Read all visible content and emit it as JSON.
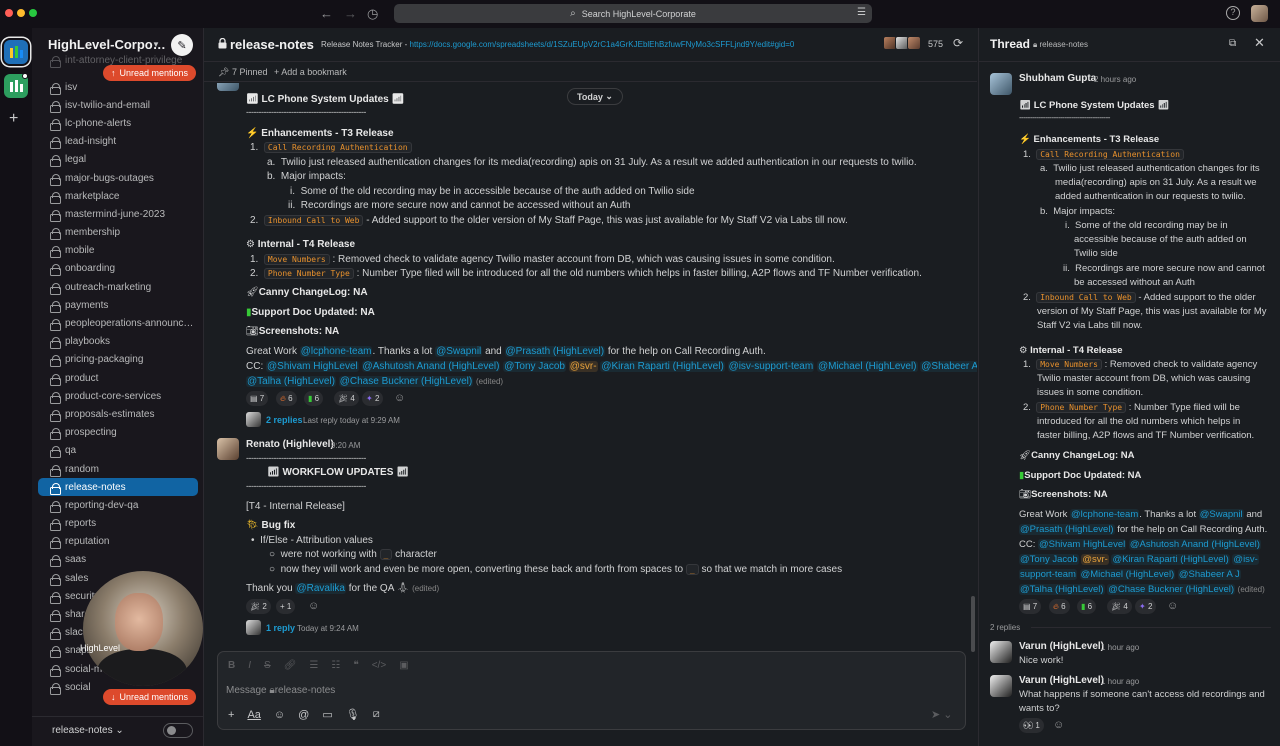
{
  "search": {
    "placeholder": "Search HighLevel-Corporate"
  },
  "workspace": {
    "name": "HighLevel-Corpo…"
  },
  "sidebar": {
    "partial_top": "int-attorney-client-privilege",
    "unread_label": "Unread mentions",
    "channels": [
      "isv",
      "isv-twilio-and-email",
      "lc-phone-alerts",
      "lead-insight",
      "legal",
      "major-bugs-outages",
      "marketplace",
      "mastermind-june-2023",
      "membership",
      "mobile",
      "onboarding",
      "outreach-marketing",
      "payments",
      "peopleoperations-announc…",
      "playbooks",
      "pricing-packaging",
      "product",
      "product-core-services",
      "proposals-estimates",
      "prospecting",
      "qa",
      "random",
      "release-notes",
      "reporting-dev-qa",
      "reports",
      "reputation",
      "saas",
      "sales",
      "security",
      "shared",
      "slack-help",
      "snapshots",
      "social-media-posting",
      "social"
    ],
    "selected": "release-notes",
    "footer_label": "release-notes",
    "video_label": "HighLevel"
  },
  "channel": {
    "title": "release-notes",
    "tracker_label": "Release Notes Tracker -",
    "tracker_link": "https://docs.google.com/spreadsheets/d/1SZuEUpV2rC1a4GrKJEblEhBzfuwFNyMo3cSFFLjnd9Y/edit#gid=0",
    "member_count": "575",
    "pinned": "7 Pinned",
    "add_bookmark": "Add a bookmark",
    "today": "Today"
  },
  "msg1": {
    "heading": "LC Phone System Updates",
    "dashes": "------------------------------------------------",
    "enh_title": "Enhancements - T3 Release",
    "item1_code": "Call Recording Authentication",
    "item1_a": "Twilio just released authentication changes for its media(recording) apis on 31 July. As a result we added authentication in our requests to twilio.",
    "item1_b": "Major impacts:",
    "item1_b_i": "Some of the old recording may be in accessible because of the auth added on Twilio side",
    "item1_b_ii": "Recordings are more secure now and cannot be accessed without an Auth",
    "item2_code": "Inbound Call to Web",
    "item2_text": "- Added support to the older version of My Staff Page, this was just available for My Staff V2 via Labs till now.",
    "int_title": "Internal - T4 Release",
    "int1_code": "Move Numbers",
    "int1_text": ": Removed check to validate agency Twilio master account from DB, which was causing issues in some condition.",
    "int2_code": "Phone Number Type",
    "int2_text": ": Number Type filed will be introduced for all the old numbers which helps in faster billing, A2P flows and TF Number verification.",
    "canny": "Canny ChangeLog: NA",
    "support": "Support Doc Updated: NA",
    "screens": "Screenshots: NA",
    "thanks_pre": "Great Work",
    "m_lcphone": "@lcphone-team",
    "thanks_mid": ". Thanks a lot",
    "m_swapnil": "@Swapnil",
    "and": "and",
    "m_prasath": "@Prasath (HighLevel)",
    "thanks_post": "for the help on Call Recording Auth.",
    "cc": "CC:",
    "m_shivam": "@Shivam HighLevel",
    "m_ashutosh": "@Ashutosh Anand (HighLevel)",
    "m_tony": "@Tony Jacob",
    "m_svr": "@svr-",
    "m_kiran": "@Kiran Raparti (HighLevel)",
    "m_isv": "@isv-support-team",
    "m_michael": "@Michael (HighLevel)",
    "m_shabeer": "@Shabeer A J",
    "m_talha": "@Talha (HighLevel)",
    "m_chase": "@Chase Buckner (HighLevel)",
    "edited": "(edited)",
    "reactions": [
      "7",
      "6",
      "6",
      "4",
      "2"
    ],
    "replies": "2 replies",
    "last_reply": "Last reply today at 9:29 AM"
  },
  "msg2": {
    "author": "Renato (Highlevel)",
    "time": "9:20 AM",
    "dashes": "------------------------------------------------",
    "heading": "WORKFLOW UPDATES",
    "release": "[T4 - Internal Release]",
    "bugfix": "Bug fix",
    "bullet": "If/Else - Attribution values",
    "sub1_pre": "were not working with",
    "sub1_code": "_",
    "sub1_post": "character",
    "sub2_pre": "now they will work and even be more open, converting these back and forth from spaces to",
    "sub2_code": "_",
    "sub2_post": "so that we match in more cases",
    "thanks_pre": "Thank you",
    "m_ravalika": "@Ravalika",
    "thanks_post": "for the QA",
    "edited": "(edited)",
    "reactions": [
      "2",
      "1"
    ],
    "replies": "1 reply",
    "last_reply": "Today at 9:24 AM"
  },
  "composer": {
    "placeholder": "Message",
    "channel": "release-notes"
  },
  "thread": {
    "title": "Thread",
    "channel": "release-notes",
    "author": "Shubham Gupta",
    "time": "2 hours ago",
    "heading": "LC Phone System Updates",
    "dashes": "------------------------------------------",
    "enh_title": "Enhancements - T3 Release",
    "item1_code": "Call Recording Authentication",
    "a1": "Twilio just released authentication changes for its",
    "a2": "media(recording) apis on 31 July. As a result we",
    "a3": "added authentication in our requests to twilio.",
    "b": "Major impacts:",
    "i1": "Some of the old recording may be in",
    "i2": "accessible because of the auth added on",
    "i3": "Twilio side",
    "ii1": "Recordings are more secure now and cannot",
    "ii2": "be accessed without an Auth",
    "item2_code": "Inbound Call to Web",
    "item2_l1": "- Added support to the older",
    "item2_l2": "version of My Staff Page, this was just available for My",
    "item2_l3": "Staff V2 via Labs till now.",
    "int_title": "Internal - T4 Release",
    "int1_code": "Move Numbers",
    "int1_l1": ": Removed check to validate agency",
    "int1_l2": "Twilio master account from DB, which was causing",
    "int1_l3": "issues in some condition.",
    "int2_code": "Phone Number Type",
    "int2_l1": ": Number Type filed will be",
    "int2_l2": "introduced for all the old numbers which helps in",
    "int2_l3": "faster billing, A2P flows and TF Number verification.",
    "canny": "Canny ChangeLog: NA",
    "support": "Support Doc Updated: NA",
    "screens": "Screenshots: NA",
    "reply_count": "2 replies",
    "replies": [
      {
        "author": "Varun (HighLevel)",
        "time": "1 hour ago",
        "text": "Nice work!"
      },
      {
        "author": "Varun (HighLevel)",
        "time": "1 hour ago",
        "text": "What happens if someone can't access old recordings and",
        "text2": "wants to?"
      }
    ],
    "reply_reaction": "1"
  }
}
